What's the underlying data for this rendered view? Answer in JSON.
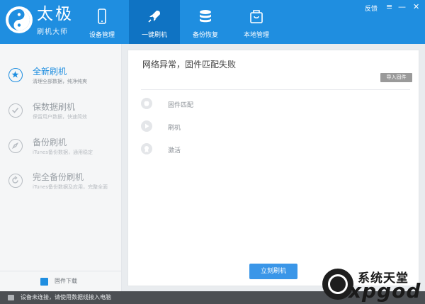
{
  "header": {
    "brand_main": "太极",
    "brand_sub": "刷机大师",
    "tabs": [
      {
        "label": "设备管理",
        "icon": "phone-icon",
        "active": false
      },
      {
        "label": "一键刷机",
        "icon": "rocket-icon",
        "active": true
      },
      {
        "label": "备份恢复",
        "icon": "database-icon",
        "active": false
      },
      {
        "label": "本地管理",
        "icon": "bag-icon",
        "active": false
      }
    ],
    "feedback_label": "反馈",
    "menu_glyph": "≡",
    "minimize_glyph": "—",
    "close_glyph": "✕",
    "accent_color": "#1f8ee0"
  },
  "sidebar": {
    "items": [
      {
        "title": "全新刷机",
        "desc": "清理全部数据，纯净纯爽",
        "icon": "star-icon",
        "active": true
      },
      {
        "title": "保数据刷机",
        "desc": "保留用户数据，快速简效",
        "icon": "check-icon",
        "active": false
      },
      {
        "title": "备份刷机",
        "desc": "iTunes备份数据，通用稳定",
        "icon": "compass-icon",
        "active": false
      },
      {
        "title": "完全备份刷机",
        "desc": "iTunes备份数据及应用，完整全面",
        "icon": "refresh-icon",
        "active": false
      }
    ],
    "download_label": "固件下载",
    "download_icon": "cube-icon"
  },
  "main": {
    "title": "网络异常，固件匹配失败",
    "import_label": "导入固件",
    "steps": [
      {
        "label": "固件匹配",
        "icon": "apple-icon"
      },
      {
        "label": "刷机",
        "icon": "play-icon"
      },
      {
        "label": "激活",
        "icon": "badge-icon"
      }
    ],
    "flash_label": "立刻刷机"
  },
  "statusbar": {
    "text": "设备未连接，请使用数据线接入电脑"
  },
  "watermark": {
    "top": "系统天堂",
    "bottom": "xpgod"
  }
}
